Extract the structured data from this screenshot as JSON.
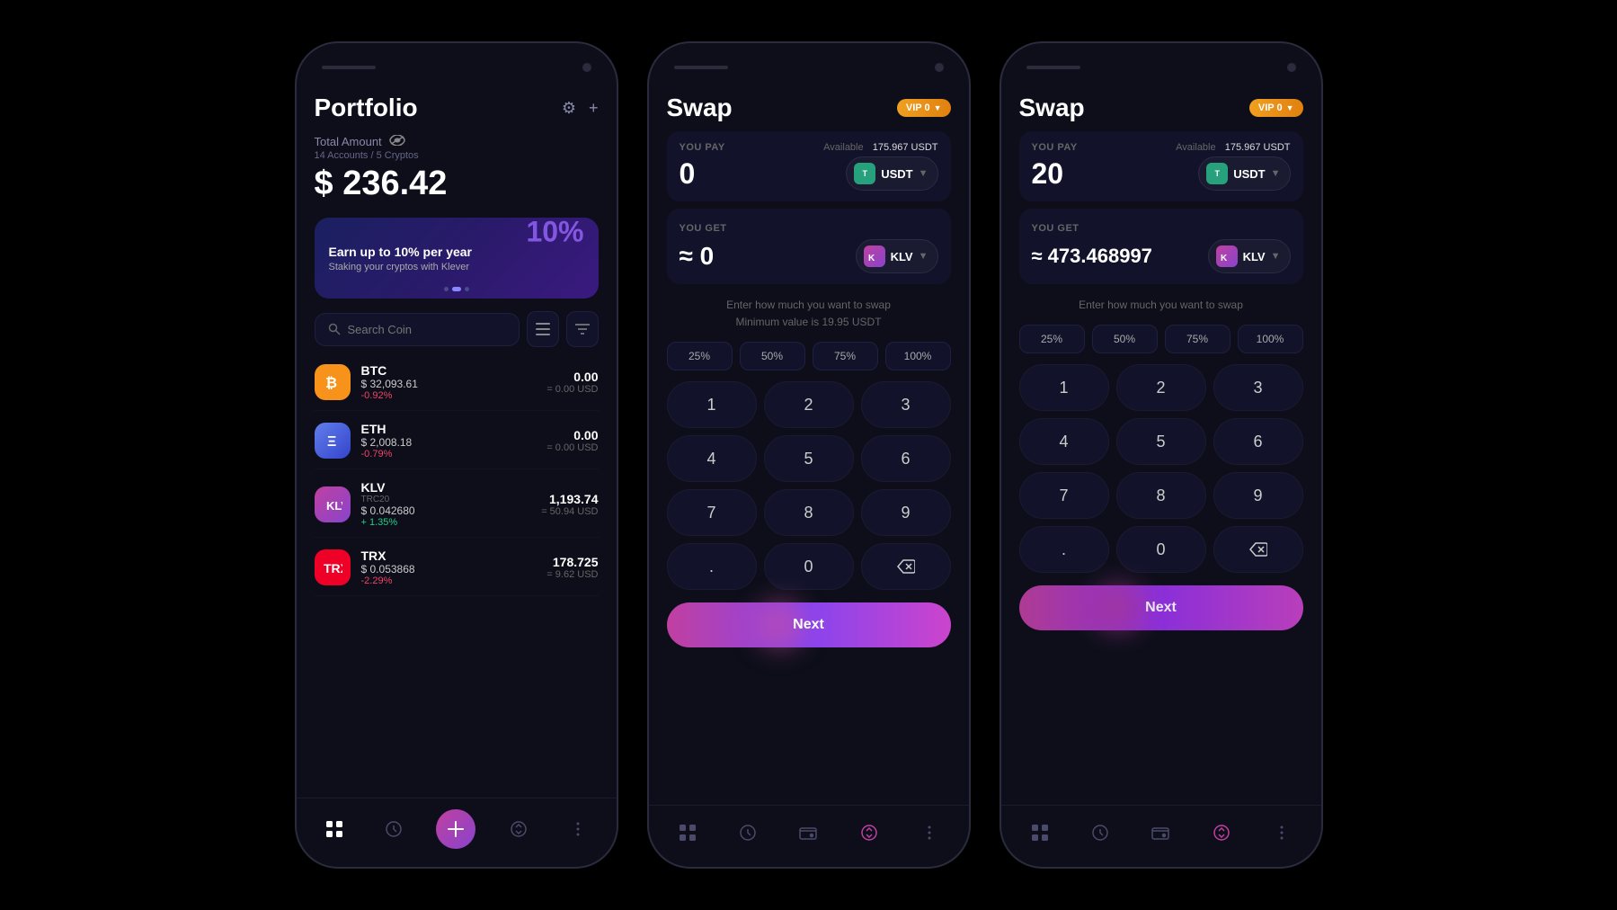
{
  "phones": {
    "portfolio": {
      "title": "Portfolio",
      "settings_icon": "⚙",
      "add_icon": "+",
      "total_label": "Total Amount",
      "eye_icon": "👁",
      "accounts_info": "14 Accounts / 5 Cryptos",
      "total_value": "$ 236.42",
      "banner": {
        "title": "Earn up to 10% per year",
        "subtitle": "Staking your cryptos with Klever",
        "graphic": "10%"
      },
      "search_placeholder": "Search Coin",
      "coins": [
        {
          "id": "btc",
          "logo_class": "btc",
          "name": "BTC",
          "tag": "",
          "price": "$ 32,093.61",
          "change": "-0.92%",
          "change_type": "neg",
          "amount": "0.00",
          "usd": "= 0.00 USD"
        },
        {
          "id": "eth",
          "logo_class": "eth",
          "name": "ETH",
          "tag": "",
          "price": "$ 2,008.18",
          "change": "-0.79%",
          "change_type": "neg",
          "amount": "0.00",
          "usd": "= 0.00 USD"
        },
        {
          "id": "klv",
          "logo_class": "klv",
          "name": "KLV",
          "tag": "TRC20",
          "price": "$ 0.042680",
          "change": "+ 1.35%",
          "change_type": "pos",
          "amount": "1,193.74",
          "usd": "= 50.94 USD"
        },
        {
          "id": "trx",
          "logo_class": "trx",
          "name": "TRX",
          "tag": "",
          "price": "$ 0.053868",
          "change": "-2.29%",
          "change_type": "neg",
          "amount": "178.725",
          "usd": "= 9.62 USD"
        }
      ],
      "nav": [
        "portfolio",
        "history",
        "wallet",
        "swap",
        "menu"
      ]
    },
    "swap1": {
      "title": "Swap",
      "vip": "VIP 0",
      "you_pay_label": "YOU PAY",
      "available_label": "Available",
      "available_value": "175.967 USDT",
      "pay_amount": "0",
      "pay_coin": "USDT",
      "you_get_label": "YOU GET",
      "get_amount": "≈ 0",
      "get_coin": "KLV",
      "hint_line1": "Enter how much you want to swap",
      "hint_line2": "Minimum value is 19.95 USDT",
      "percents": [
        "25%",
        "50%",
        "75%",
        "100%"
      ],
      "numpad": [
        "1",
        "2",
        "3",
        "4",
        "5",
        "6",
        "7",
        "8",
        "9",
        ".",
        "0",
        "⌫"
      ],
      "next_label": "Next",
      "nav": [
        "portfolio",
        "history",
        "wallet",
        "swap",
        "menu"
      ]
    },
    "swap2": {
      "title": "Swap",
      "vip": "VIP 0",
      "you_pay_label": "YOU PAY",
      "available_label": "Available",
      "available_value": "175.967 USDT",
      "pay_amount": "20",
      "pay_coin": "USDT",
      "you_get_label": "YOU GET",
      "get_amount": "≈ 473.468997",
      "get_coin": "KLV",
      "hint_line1": "Enter how much you want to swap",
      "percents": [
        "25%",
        "50%",
        "75%",
        "100%"
      ],
      "numpad": [
        "1",
        "2",
        "3",
        "4",
        "5",
        "6",
        "7",
        "8",
        "9",
        ".",
        "0",
        "⌫"
      ],
      "next_label": "Next",
      "nav": [
        "portfolio",
        "history",
        "wallet",
        "swap",
        "menu"
      ]
    }
  }
}
